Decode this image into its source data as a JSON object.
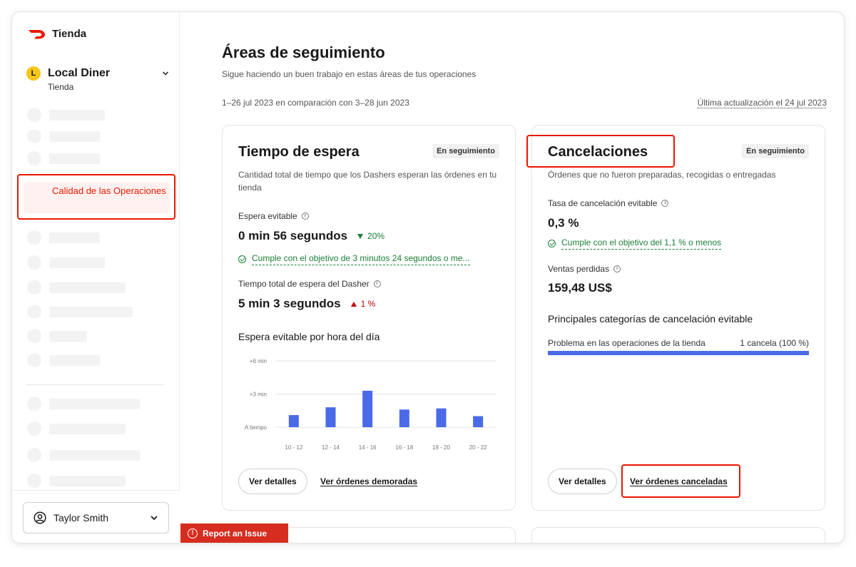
{
  "sidebar": {
    "brand": "Tienda",
    "store": {
      "initial": "L",
      "name": "Local Diner",
      "subtitle": "Tienda"
    },
    "active_item": "Calidad de las Operaciones",
    "user": {
      "name": "Taylor Smith"
    }
  },
  "header": {
    "title": "Áreas de seguimiento",
    "subtitle": "Sigue haciendo un buen trabajo en estas áreas de tus operaciones",
    "date_range": "1–26 jul 2023 en comparación con 3–28 jun 2023",
    "last_update": "Última actualización el 24 jul 2023"
  },
  "wait_card": {
    "title": "Tiempo de espera",
    "badge": "En seguimiento",
    "description": "Cantidad total de tiempo que los Dashers esperan las órdenes en tu tienda",
    "avoidable_label": "Espera evitable",
    "avoidable_value": "0 min 56 segundos",
    "avoidable_delta": "20%",
    "avoidable_goal": "Cumple con el objetivo de 3 minutos 24 segundos o me...",
    "total_label": "Tiempo total de espera del Dasher",
    "total_value": "5 min 3 segundos",
    "total_delta": "1 %",
    "chart_title": "Espera evitable por hora del día",
    "details_button": "Ver detalles",
    "link": "Ver órdenes demoradas"
  },
  "cancel_card": {
    "title": "Cancelaciones",
    "badge": "En seguimiento",
    "description": "Órdenes que no fueron preparadas, recogidas o entregadas",
    "rate_label": "Tasa de cancelación evitable",
    "rate_value": "0,3 %",
    "rate_goal": "Cumple con el objetivo del 1,1 % o menos",
    "lost_label": "Ventas perdidas",
    "lost_value": "159,48 US$",
    "categories_title": "Principales categorías de cancelación evitable",
    "categories": [
      {
        "label": "Problema en las operaciones de la tienda",
        "count": "1 cancela (100 %)",
        "share": 1.0
      }
    ],
    "details_button": "Ver detalles",
    "link": "Ver órdenes canceladas"
  },
  "report_issue": "Report an Issue",
  "colors": {
    "accent": "#eb1700",
    "bar": "#4a6ae8",
    "good": "#1a7f37",
    "bad": "#c00000"
  },
  "chart_data": {
    "type": "bar",
    "categories": [
      "10 - 12",
      "12 - 14",
      "14 - 16",
      "16 - 18",
      "18 - 20",
      "20 - 22"
    ],
    "values": [
      1.1,
      1.8,
      3.3,
      1.6,
      1.7,
      1.0
    ],
    "ylim": [
      0,
      6
    ],
    "y_ticks": [
      {
        "value": 0,
        "label": "A tiempo"
      },
      {
        "value": 3,
        "label": "+3 min"
      },
      {
        "value": 6,
        "label": "+6 min"
      }
    ],
    "grid": true
  }
}
